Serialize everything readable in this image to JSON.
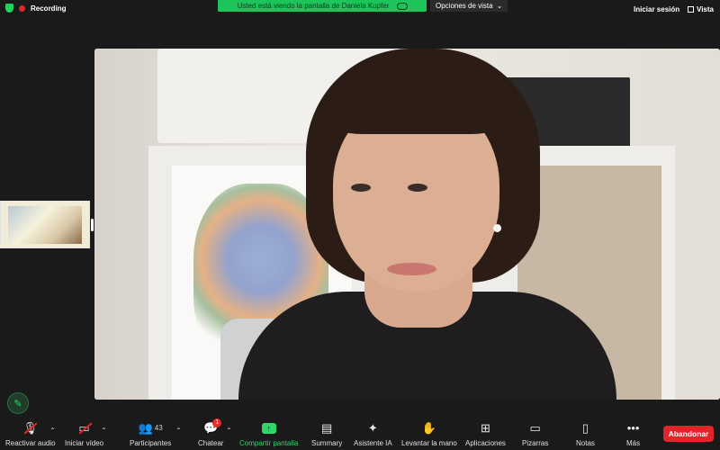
{
  "status": {
    "recording_label": "Recording",
    "recording_color": "#e02828",
    "security_color": "#23d160"
  },
  "share_banner": {
    "text": "Usted está viendo la pantalla de Daniela Kupfer",
    "color": "#1cc45a"
  },
  "view_options": {
    "label": "Opciones de vista"
  },
  "top_right": {
    "signin_label": "Iniciar sesión",
    "view_label": "Vista"
  },
  "toolbar": {
    "audio_label": "Reactivar audio",
    "video_label": "Iniciar vídeo",
    "participants_label": "Participantes",
    "participants_count": "43",
    "chat_label": "Chatear",
    "chat_badge": "1",
    "share_label": "Compartir pantalla",
    "summary_label": "Summary",
    "assistant_label": "Asistente IA",
    "raise_hand_label": "Levantar la mano",
    "apps_label": "Aplicaciones",
    "whiteboards_label": "Pizarras",
    "notes_label": "Notas",
    "more_label": "Más",
    "leave_label": "Abandonar",
    "leave_color": "#e0242a"
  },
  "icons": [
    "shield-icon",
    "record-dot-icon",
    "cloud-icon",
    "chevron-down-icon",
    "grid-icon",
    "microphone-muted-icon",
    "video-muted-icon",
    "participants-icon",
    "chat-icon",
    "share-screen-icon",
    "summary-icon",
    "sparkle-icon",
    "hand-icon",
    "apps-icon",
    "whiteboard-icon",
    "notes-icon",
    "more-icon",
    "pencil-icon"
  ]
}
